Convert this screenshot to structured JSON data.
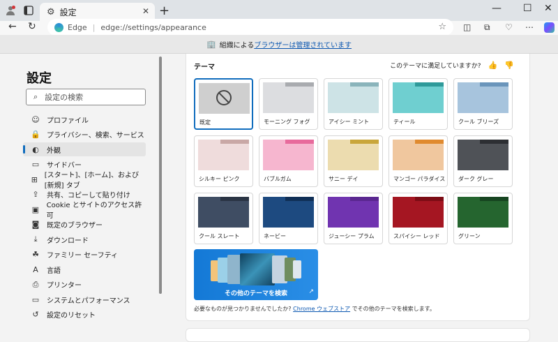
{
  "tab": {
    "title": "設定"
  },
  "address": {
    "site_label": "Edge",
    "url": "edge://settings/appearance"
  },
  "managed_bar": {
    "prefix": "組織による",
    "link": "ブラウザーは管理されています"
  },
  "sidebar": {
    "title": "設定",
    "search_placeholder": "設定の検索",
    "items": [
      {
        "label": "プロファイル",
        "icon": "person-icon"
      },
      {
        "label": "プライバシー、検索、サービス",
        "icon": "lock-icon"
      },
      {
        "label": "外観",
        "icon": "appearance-icon",
        "active": true
      },
      {
        "label": "サイドバー",
        "icon": "sidebar-icon"
      },
      {
        "label": "[スタート]、[ホーム]、および [新規] タブ",
        "icon": "newtab-icon"
      },
      {
        "label": "共有、コピーして貼り付け",
        "icon": "share-icon"
      },
      {
        "label": "Cookie とサイトのアクセス許可",
        "icon": "cookie-icon"
      },
      {
        "label": "既定のブラウザー",
        "icon": "browser-icon"
      },
      {
        "label": "ダウンロード",
        "icon": "download-icon"
      },
      {
        "label": "ファミリー セーフティ",
        "icon": "family-icon"
      },
      {
        "label": "言語",
        "icon": "language-icon"
      },
      {
        "label": "プリンター",
        "icon": "printer-icon"
      },
      {
        "label": "システムとパフォーマンス",
        "icon": "laptop-icon"
      },
      {
        "label": "設定のリセット",
        "icon": "reset-icon"
      }
    ]
  },
  "themes": {
    "title": "テーマ",
    "feedback_question": "このテーマに満足していますか?",
    "tiles": [
      {
        "label": "既定",
        "tab": "#cfcfcf",
        "back": "#cfcfcf",
        "body": "#cfcfcf",
        "default": true
      },
      {
        "label": "モーニング フォグ",
        "tab": "#dcdde0",
        "back": "#a9abaf",
        "body": "#dcdde0"
      },
      {
        "label": "アイシー ミント",
        "tab": "#cde3e6",
        "back": "#8ab4bb",
        "body": "#cde3e6"
      },
      {
        "label": "ティール",
        "tab": "#6fcfd0",
        "back": "#2f9a9a",
        "body": "#6fcfd0"
      },
      {
        "label": "クール ブリーズ",
        "tab": "#a7c4dd",
        "back": "#6a95bb",
        "body": "#a7c4dd"
      },
      {
        "label": "シルキー ピンク",
        "tab": "#efdcdc",
        "back": "#c9a8a6",
        "body": "#efdcdc"
      },
      {
        "label": "バブルガム",
        "tab": "#f6b6cf",
        "back": "#e86a9c",
        "body": "#f6b6cf"
      },
      {
        "label": "サニー デイ",
        "tab": "#ecdcaf",
        "back": "#c9a63b",
        "body": "#ecdcaf"
      },
      {
        "label": "マンゴー パラダイス",
        "tab": "#f0c79e",
        "back": "#e08a2e",
        "body": "#f0c79e"
      },
      {
        "label": "ダーク グレー",
        "tab": "#4f5257",
        "back": "#2d2f33",
        "body": "#4f5257"
      },
      {
        "label": "クール スレート",
        "tab": "#3f4d63",
        "back": "#2a3444",
        "body": "#3f4d63"
      },
      {
        "label": "ネービー",
        "tab": "#1d4a80",
        "back": "#102f56",
        "body": "#1d4a80"
      },
      {
        "label": "ジューシー プラム",
        "tab": "#7034b0",
        "back": "#5a2790",
        "body": "#7034b0"
      },
      {
        "label": "スパイシー レッド",
        "tab": "#a51622",
        "back": "#7c0c15",
        "body": "#a51622"
      },
      {
        "label": "グリーン",
        "tab": "#25652f",
        "back": "#164420",
        "body": "#25652f"
      }
    ],
    "more_themes_label": "その他のテーマを検索",
    "note_prefix": "必要なものが見つかりませんでしたか?",
    "note_link": "Chrome ウェブストア",
    "note_suffix": "でその他のテーマを検索します。"
  }
}
